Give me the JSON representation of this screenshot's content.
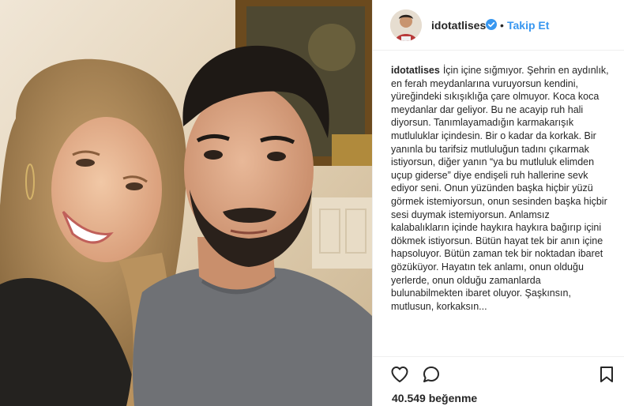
{
  "post": {
    "image_alt": "selfie of a smiling couple",
    "username": "idotatlises",
    "separator": "•",
    "follow_label": "Takip Et",
    "caption_username": "idotatlises",
    "caption_text": "İçin içine sığmıyor. Şehrin en aydınlık, en ferah meydanlarına vuruyorsun kendini, yüreğindeki sıkışıklığa çare olmuyor. Koca koca meydanlar dar geliyor. Bu ne acayip ruh hali diyorsun. Tanımlayamadığın karmakarışık mutluluklar içindesin. Bir o kadar da korkak. Bir yanınla bu tarifsiz mutluluğun tadını çıkarmak istiyorsun, diğer yanın “ya bu mutluluk elimden uçup giderse” diye endişeli ruh hallerine sevk ediyor seni. Onun yüzünden başka hiçbir yüzü görmek istemiyorsun, onun sesinden başka hiçbir sesi duymak istemiyorsun. Anlamsız kalabalıkların içinde haykıra haykıra bağırıp içini dökmek istiyorsun. Bütün hayat tek bir anın içine hapsoluyor. Bütün zaman tek bir noktadan ibaret gözüküyor. Hayatın tek anlamı, onun olduğu yerlerde, onun olduğu zamanlarda bulunabilmekten ibaret oluyor. Şaşkınsın, mutlusun, korkaksın...",
    "likes_count": "40.549",
    "likes_word": "beğenme",
    "accent_color": "#3897f0",
    "verified_color": "#3897f0",
    "icons": {
      "like": "heart-outline-icon",
      "comment": "speech-bubble-icon",
      "save": "bookmark-icon",
      "verified": "verified-badge-icon"
    }
  }
}
